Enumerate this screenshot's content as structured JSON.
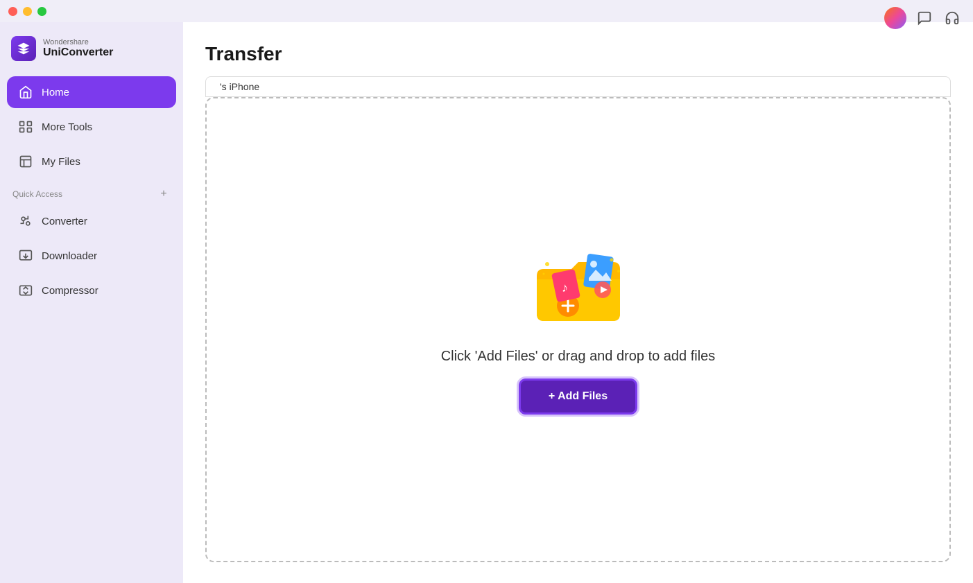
{
  "app": {
    "brand": "Wondershare",
    "name": "UniConverter"
  },
  "titlebar": {
    "traffic_lights": [
      "close",
      "minimize",
      "maximize"
    ]
  },
  "sidebar": {
    "nav_items": [
      {
        "id": "home",
        "label": "Home",
        "active": true
      },
      {
        "id": "more-tools",
        "label": "More Tools",
        "active": false
      },
      {
        "id": "my-files",
        "label": "My Files",
        "active": false
      }
    ],
    "quick_access_label": "Quick Access",
    "add_label": "+",
    "quick_items": [
      {
        "id": "converter",
        "label": "Converter"
      },
      {
        "id": "downloader",
        "label": "Downloader"
      },
      {
        "id": "compressor",
        "label": "Compressor"
      }
    ]
  },
  "main": {
    "title": "Transfer",
    "device_tab": "'s iPhone",
    "drop_zone": {
      "instruction": "Click 'Add Files' or drag and drop to add files",
      "add_button_label": "+ Add Files"
    }
  },
  "topbar": {
    "chat_icon": "💬",
    "headset_icon": "🎧"
  }
}
